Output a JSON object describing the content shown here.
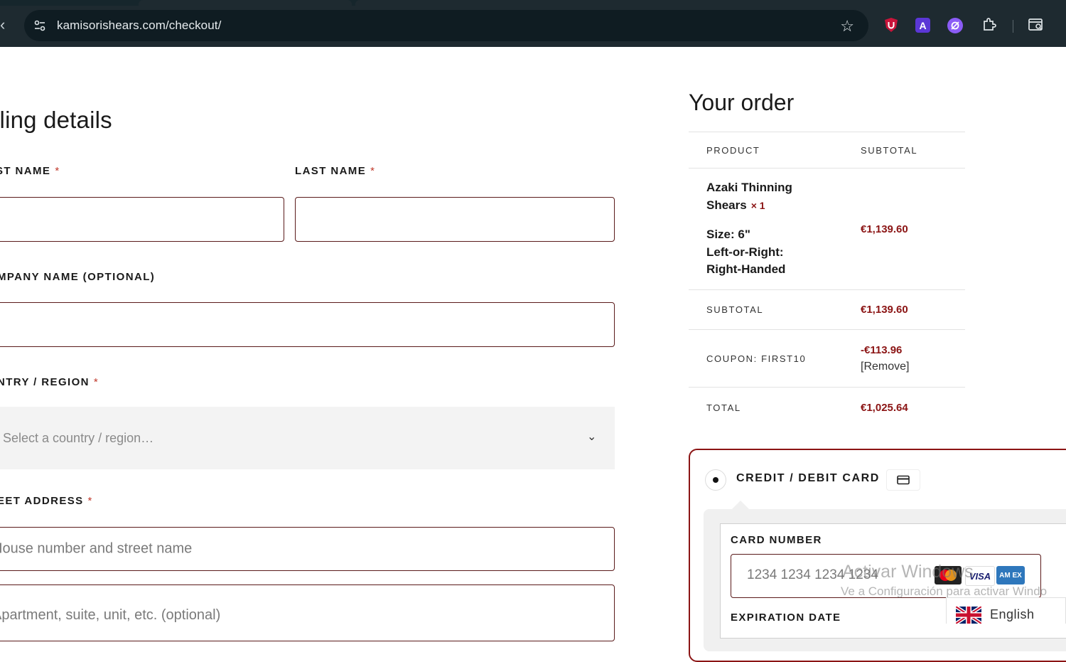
{
  "browser": {
    "url": "kamisorishears.com/checkout/",
    "icons": {
      "back": "back-arrow-icon",
      "site": "site-settings-icon",
      "bookmark": "star-icon",
      "extensions": [
        "ublock-origin-icon",
        "a-extension-icon",
        "c-extension-icon",
        "puzzle-extensions-icon",
        "tab-search-icon"
      ]
    },
    "ext_a_letter": "A"
  },
  "billing": {
    "title": "lling details",
    "first_name_label": "ST NAME",
    "last_name_label": "LAST NAME",
    "company_label": "MPANY NAME (OPTIONAL)",
    "country_label": "NTRY / REGION",
    "country_placeholder": "Select a country / region…",
    "street_label": "EET ADDRESS",
    "street_placeholder": "House number and street name",
    "apartment_placeholder": "Apartment, suite, unit, etc. (optional)",
    "required_mark": "*"
  },
  "order": {
    "title": "Your order",
    "col_product": "PRODUCT",
    "col_subtotal": "SUBTOTAL",
    "product_name_line1": "Azaki Thinning",
    "product_name_line2": "Shears",
    "product_qty": "× 1",
    "meta_size": "Size: 6\"",
    "meta_hand_label": "Left-or-Right:",
    "meta_hand_value": "Right-Handed",
    "product_price": "€1,139.60",
    "subtotal_label": "SUBTOTAL",
    "subtotal_value": "€1,139.60",
    "coupon_label": "COUPON: FIRST10",
    "coupon_value": "-€113.96",
    "coupon_remove": "[Remove]",
    "total_label": "TOTAL",
    "total_value": "€1,025.64"
  },
  "payment": {
    "method_label": "CREDIT / DEBIT CARD",
    "card_number_label": "CARD NUMBER",
    "card_number_placeholder": "1234 1234 1234 1234",
    "expiration_label": "EXPIRATION DATE",
    "brands": [
      "VISA",
      "AM EX"
    ]
  },
  "watermark": {
    "line1": "Activar Windows",
    "line2": "Ve a Configuración para activar Windo"
  },
  "language": {
    "label": "English"
  },
  "colors": {
    "accent": "#8b1414",
    "field_border": "#5a1a1a",
    "chrome_bg": "#1e2a30"
  }
}
